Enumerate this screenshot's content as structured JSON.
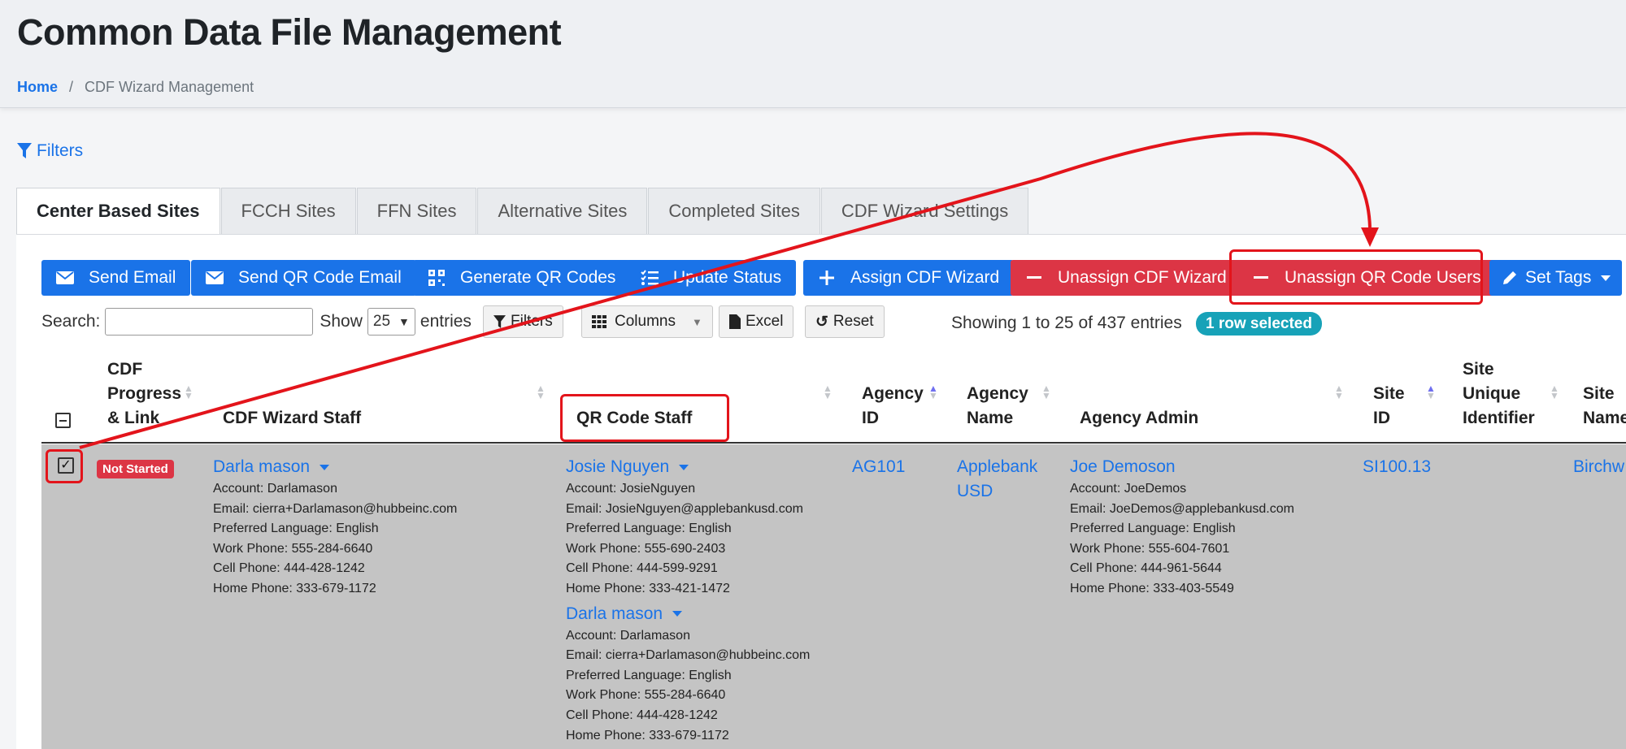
{
  "header": {
    "title": "Common Data File Management",
    "breadcrumb": {
      "home": "Home",
      "separator": "/",
      "current": "CDF Wizard Management"
    }
  },
  "filters_link": "Filters",
  "tabs": [
    {
      "label": "Center Based Sites",
      "active": true
    },
    {
      "label": "FCCH Sites"
    },
    {
      "label": "FFN Sites"
    },
    {
      "label": "Alternative Sites"
    },
    {
      "label": "Completed Sites"
    },
    {
      "label": "CDF Wizard Settings"
    }
  ],
  "toolbar": {
    "send_email": "Send Email",
    "send_qr_email": "Send QR Code Email",
    "generate_qr": "Generate QR Codes",
    "update_status": "Update Status",
    "assign_cdf": "Assign CDF Wizard",
    "unassign_cdf": "Unassign CDF Wizard",
    "unassign_qr": "Unassign QR Code Users",
    "set_tags": "Set Tags"
  },
  "controls": {
    "search_label": "Search:",
    "search_value": "",
    "show_label": "Show",
    "page_size": "25",
    "entries_label": "entries",
    "filters_btn": "Filters",
    "columns_btn": "Columns",
    "excel_btn": "Excel",
    "reset_btn": "Reset",
    "showing": "Showing 1 to 25 of 437 entries",
    "selected_badge": "1 row selected"
  },
  "columns": {
    "cdf_progress": [
      "CDF",
      "Progress",
      "& Link"
    ],
    "cdf_wizard_staff": "CDF Wizard Staff",
    "qr_code_staff": "QR Code Staff",
    "agency_id": [
      "Agency",
      "ID"
    ],
    "agency_name": [
      "Agency",
      "Name"
    ],
    "agency_admin": "Agency Admin",
    "site_id": [
      "Site",
      "ID"
    ],
    "site_unique": [
      "Site",
      "Unique",
      "Identifier"
    ],
    "site_name": [
      "Site",
      "Name"
    ]
  },
  "row": {
    "status": "Not Started",
    "wizard_staff": {
      "name": "Darla mason",
      "lines": [
        "Account: Darlamason",
        "Email: cierra+Darlamason@hubbeinc.com",
        "Preferred Language: English",
        "Work Phone: 555-284-6640",
        "Cell Phone: 444-428-1242",
        "Home Phone: 333-679-1172"
      ]
    },
    "qr_staff_1": {
      "name": "Josie Nguyen",
      "lines": [
        "Account: JosieNguyen",
        "Email: JosieNguyen@applebankusd.com",
        "Preferred Language: English",
        "Work Phone: 555-690-2403",
        "Cell Phone: 444-599-9291",
        "Home Phone: 333-421-1472"
      ]
    },
    "qr_staff_2": {
      "name": "Darla mason",
      "lines": [
        "Account: Darlamason",
        "Email: cierra+Darlamason@hubbeinc.com",
        "Preferred Language: English",
        "Work Phone: 555-284-6640",
        "Cell Phone: 444-428-1242",
        "Home Phone: 333-679-1172"
      ]
    },
    "agency_id": "AG101",
    "agency_name": [
      "Applebank",
      "USD"
    ],
    "admin": {
      "name": "Joe Demoson",
      "lines": [
        "Account: JoeDemos",
        "Email: JoeDemos@applebankusd.com",
        "Preferred Language: English",
        "Work Phone: 555-604-7601",
        "Cell Phone: 444-961-5644",
        "Home Phone: 333-403-5549"
      ]
    },
    "site_id": "SI100.13",
    "site_name": "Birchw"
  },
  "colors": {
    "primary": "#1a73e8",
    "danger": "#dc3545",
    "info": "#17a2b8",
    "annotation": "#e3141b",
    "selected_row": "#c4c4c4"
  }
}
